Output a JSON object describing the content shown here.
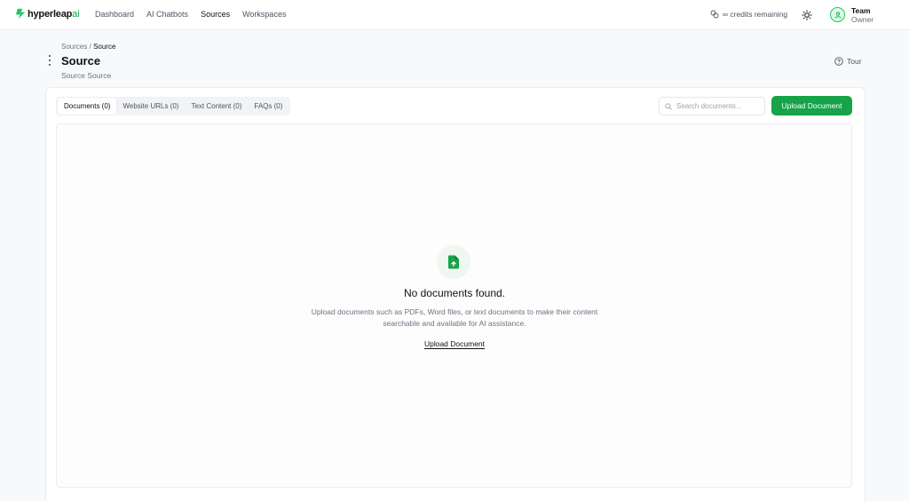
{
  "brand": {
    "name": "hyperleap",
    "suffix": "ai",
    "accent": "#16a34a"
  },
  "nav": {
    "items": [
      "Dashboard",
      "AI Chatbots",
      "Sources",
      "Workspaces"
    ],
    "active": "Sources"
  },
  "credits": {
    "label": "∞ credits remaining",
    "icon": "coins-icon"
  },
  "theme_toggle": {
    "icon": "sun-icon"
  },
  "user": {
    "name": "Team",
    "role": "Owner",
    "icon": "user-avatar-icon"
  },
  "breadcrumb": {
    "parent": "Sources",
    "separator": "/",
    "current": "Source"
  },
  "header": {
    "title": "Source",
    "subtitle": "Source Source",
    "tour_label": "Tour"
  },
  "tabs": [
    {
      "label": "Documents (0)",
      "active": true
    },
    {
      "label": "Website URLs (0)",
      "active": false
    },
    {
      "label": "Text Content (0)",
      "active": false
    },
    {
      "label": "FAQs (0)",
      "active": false
    }
  ],
  "search": {
    "placeholder": "Search documents...",
    "value": ""
  },
  "toolbar": {
    "upload_label": "Upload Document"
  },
  "empty_state": {
    "icon": "file-upload-icon",
    "title": "No documents found.",
    "description": "Upload documents such as PDFs, Word files, or text documents to make their content searchable and available for AI assistance.",
    "action_label": "Upload Document"
  }
}
